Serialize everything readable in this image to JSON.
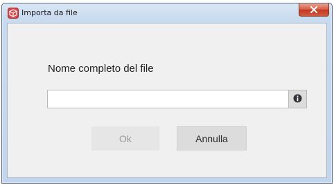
{
  "window": {
    "title": "Importa da file",
    "app_icon": "app-icon",
    "close_icon": "close-icon",
    "close_color": "#c8462c"
  },
  "form": {
    "label": "Nome completo del file",
    "input_value": "",
    "input_placeholder": "",
    "help_icon": "info-icon"
  },
  "buttons": {
    "ok_label": "Ok",
    "cancel_label": "Annulla"
  }
}
